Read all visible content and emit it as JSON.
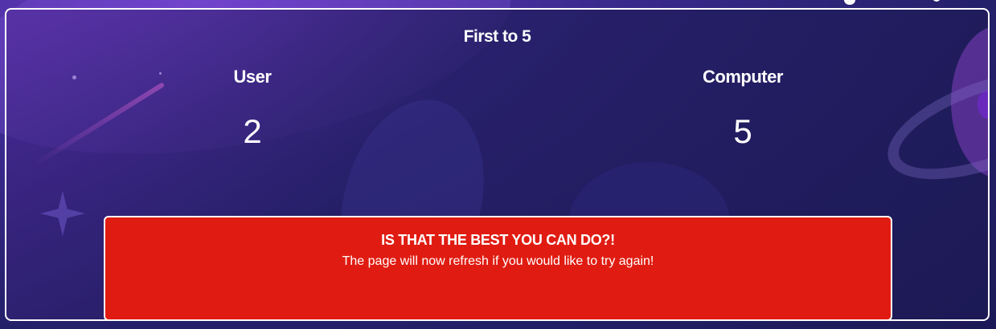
{
  "game": {
    "title": "First to 5"
  },
  "players": {
    "user": {
      "label": "User",
      "score": "2"
    },
    "computer": {
      "label": "Computer",
      "score": "5"
    }
  },
  "result": {
    "heading": "IS THAT THE BEST YOU CAN DO?!",
    "message": "The page will now refresh if you would like to try again!",
    "color": "#e01c12"
  },
  "theme": {
    "background": "#24206a",
    "accent": "#6a3cc4"
  }
}
